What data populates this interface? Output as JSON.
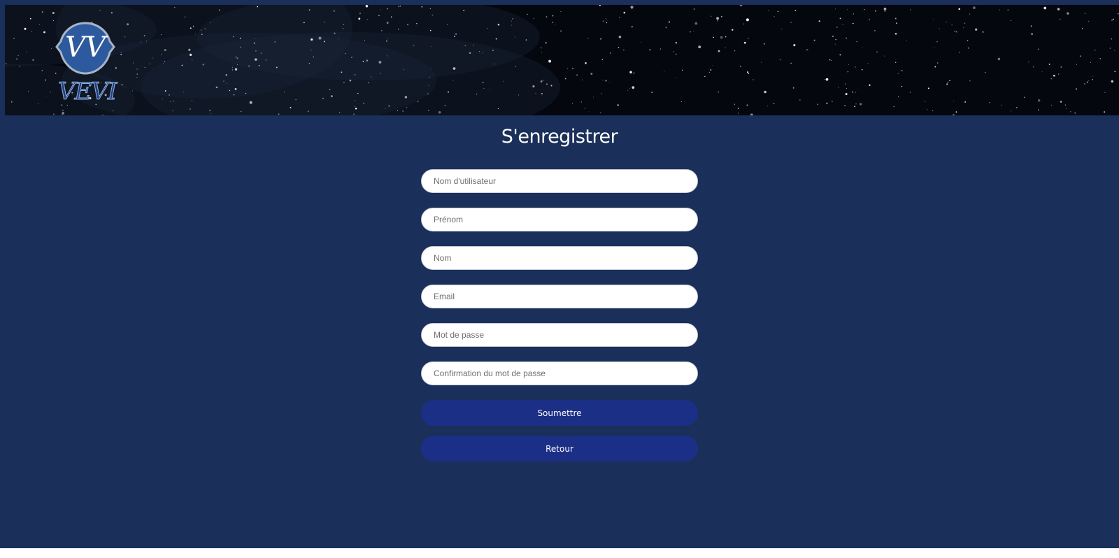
{
  "header": {
    "logo_monogram": "VV",
    "logo_wordmark": "VEVI"
  },
  "form": {
    "title": "S'enregistrer",
    "fields": {
      "username_placeholder": "Nom d'utilisateur",
      "firstname_placeholder": "Prénom",
      "lastname_placeholder": "Nom",
      "email_placeholder": "Email",
      "password_placeholder": "Mot de passe",
      "password_confirm_placeholder": "Confirmation du mot de passe"
    },
    "submit_label": "Soumettre",
    "back_label": "Retour"
  },
  "colors": {
    "page_background": "#1a2f59",
    "button_background": "#1c2f86",
    "banner_background": "#04070e",
    "logo_circle": "#2d5a9e"
  }
}
